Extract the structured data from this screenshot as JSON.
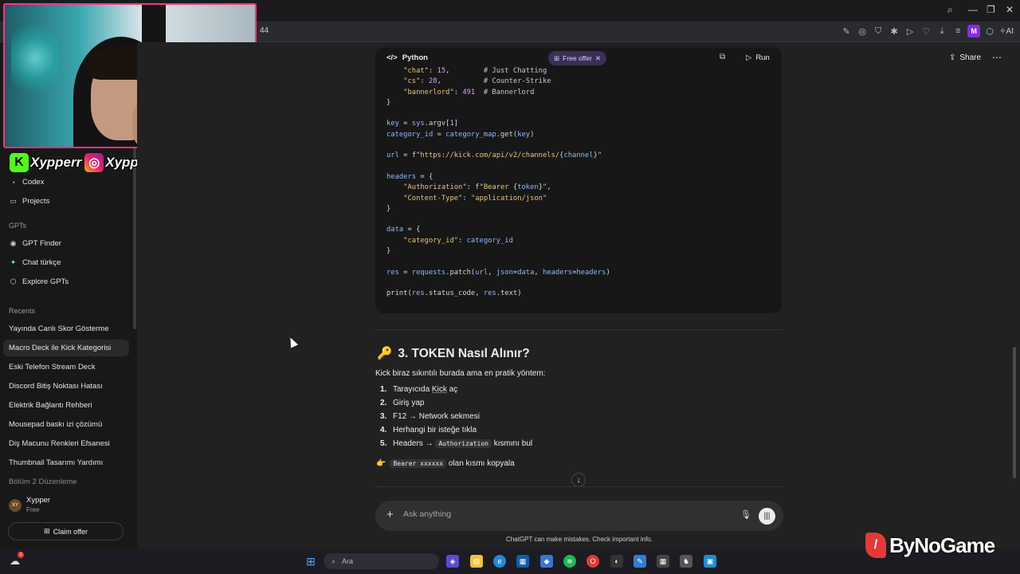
{
  "browser": {
    "tab_fragment": "44",
    "ai_label": "AI",
    "avatar_letter": "M",
    "toolbar_icons": [
      "edit-icon",
      "camera-icon",
      "shield-icon",
      "extension-icon",
      "play-icon",
      "heart-icon",
      "download-icon",
      "menu-icon"
    ]
  },
  "overlay": {
    "social_handle": "Xypperr",
    "watermark": "ByNoGame"
  },
  "sidebar": {
    "nav": [
      {
        "label": "Codex",
        "icon": "codex-icon"
      },
      {
        "label": "Projects",
        "icon": "folder-icon"
      }
    ],
    "gpts_heading": "GPTs",
    "gpts": [
      {
        "label": "GPT Finder",
        "icon": "gpt-finder-icon"
      },
      {
        "label": "Chat türkçe",
        "icon": "chat-turkce-icon"
      },
      {
        "label": "Explore GPTs",
        "icon": "explore-icon"
      }
    ],
    "recents_heading": "Recents",
    "recents": [
      "Yayında Canlı Skor Gösterme",
      "Macro Deck ile Kick Kategorisi",
      "Eski Telefon Stream Deck",
      "Discord Bitiş Noktası Hatası",
      "Elektrik Bağlantı Rehberi",
      "Mousepad baskı izi çözümü",
      "Diş Macunu Renkleri Efsanesi",
      "Thumbnail Tasarımı Yardımı",
      "Bölüm 2 Düzenleme"
    ],
    "user": {
      "initials": "XY",
      "name": "Xypper",
      "plan": "Free"
    },
    "claim_offer": "Claim offer"
  },
  "header": {
    "share": "Share",
    "more": "⋯"
  },
  "code_block": {
    "language": "Python",
    "free_offer": "Free offer",
    "run": "Run"
  },
  "section": {
    "emoji": "🔑",
    "title": "3. TOKEN Nasıl Alınır?",
    "intro": "Kick biraz sıkıntılı burada ama en pratik yöntem:",
    "steps": [
      {
        "num": "1.",
        "pre": "Tarayıcıda ",
        "link": "Kick",
        "post": " aç"
      },
      {
        "num": "2.",
        "pre": "Giriş yap",
        "link": "",
        "post": ""
      },
      {
        "num": "3.",
        "pre": "F12 → Network sekmesi",
        "link": "",
        "post": ""
      },
      {
        "num": "4.",
        "pre": "Herhangi bir isteğe tıkla",
        "link": "",
        "post": ""
      },
      {
        "num": "5.",
        "pre": "Headers → ",
        "chip": "Authorization",
        "post": " kısmını bul"
      }
    ],
    "tip_emoji": "👉",
    "tip_chip": "Bearer xxxxxx",
    "tip_text": " olan kısmı kopyala"
  },
  "composer": {
    "placeholder": "Ask anything",
    "disclaimer": "ChatGPT can make mistakes. Check important info."
  },
  "taskbar": {
    "search_label": "Ara",
    "cloud_badge": "1"
  }
}
